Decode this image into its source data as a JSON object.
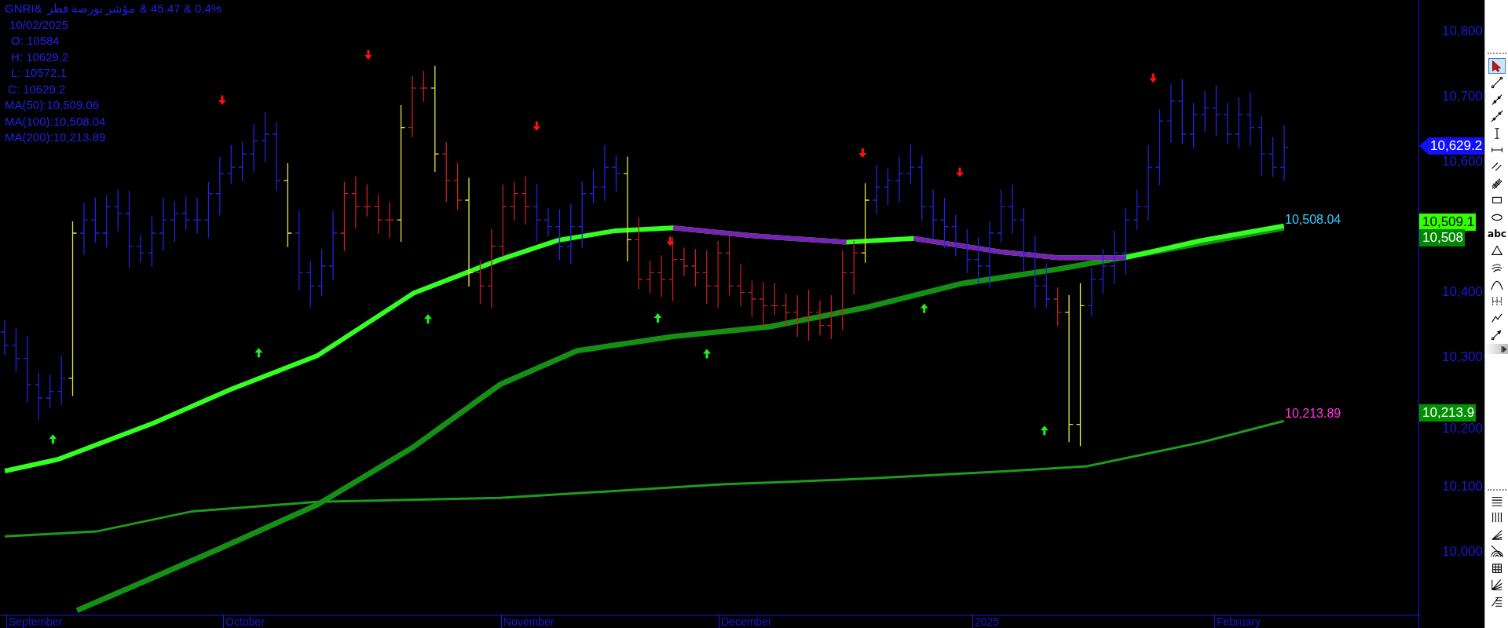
{
  "chart": {
    "title_parts": [
      "GNRI&",
      "مؤشر بورصة قطر",
      "&  45.47 & 0.4%"
    ],
    "info_lines": [
      "10/02/2025",
      "O: 10584",
      "H: 10629.2",
      "L: 10572.1",
      "C: 10629.2",
      "MA(50):10,509.06",
      "MA(100):10,508.04",
      "MA(200):10,213.89"
    ],
    "line_labels": [
      {
        "text": "10,508.04",
        "color": "#33ccff"
      },
      {
        "text": "10,213.89",
        "color": "#ff33dd"
      }
    ],
    "x_axis": [
      "September",
      "October",
      "November",
      "December",
      "2025",
      "February"
    ]
  },
  "y_axis": {
    "ticks": [
      "10,800",
      "10,700",
      "10,600",
      "10,400",
      "10,300",
      "10,200",
      "10,100",
      "10,000"
    ],
    "tags": [
      {
        "kind": "arrow",
        "text": "10,629.2",
        "color": "#1010ff"
      },
      {
        "kind": "plain",
        "text": "10,509.1",
        "color": "#33ff00"
      },
      {
        "kind": "plain",
        "text": "10,508",
        "color": "#008800"
      },
      {
        "kind": "plain",
        "text": "10,213.9",
        "color": "#009000"
      }
    ]
  },
  "toolbar": {
    "top_tools": [
      {
        "kind": "pointer",
        "selected": true
      },
      {
        "kind": "line",
        "selected": false
      },
      {
        "kind": "ray",
        "selected": false
      },
      {
        "kind": "extended",
        "selected": false
      },
      {
        "kind": "vertical",
        "selected": false
      },
      {
        "kind": "horizontal",
        "selected": false
      },
      {
        "kind": "parallel",
        "selected": false
      },
      {
        "kind": "pitchfork",
        "selected": false
      },
      {
        "kind": "rectangle",
        "selected": false
      },
      {
        "kind": "ellipse",
        "selected": false
      },
      {
        "kind": "text",
        "label": "abc",
        "selected": false
      },
      {
        "kind": "triangle",
        "selected": false
      },
      {
        "kind": "wave",
        "selected": false
      },
      {
        "kind": "arc",
        "selected": false
      },
      {
        "kind": "cycles",
        "selected": false
      },
      {
        "kind": "polyline",
        "selected": false
      },
      {
        "kind": "arrow",
        "selected": false
      }
    ],
    "bottom_tools": [
      {
        "kind": "hlines",
        "selected": false
      },
      {
        "kind": "vlines",
        "selected": false
      },
      {
        "kind": "fan",
        "selected": false
      },
      {
        "kind": "arcs",
        "selected": false
      },
      {
        "kind": "grid",
        "selected": false
      },
      {
        "kind": "speed",
        "selected": false
      },
      {
        "kind": "retrace",
        "selected": false
      }
    ]
  }
}
